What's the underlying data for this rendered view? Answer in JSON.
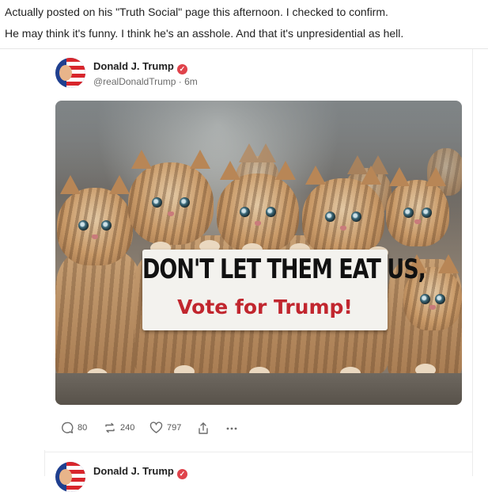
{
  "comment": {
    "line1": "Actually posted on his \"Truth Social\" page this afternoon. I checked to confirm.",
    "line2": "He may think it's funny.  I think he's an asshole.  And that it's unpresidential as hell."
  },
  "post": {
    "author_name": "Donald J. Trump",
    "handle": "@realDonaldTrump · 6m",
    "image": {
      "sign_line1": "DON'T LET THEM EAT US,",
      "sign_line2": "Vote for Trump!"
    },
    "actions": {
      "replies": "80",
      "reposts": "240",
      "likes": "797"
    }
  },
  "next_post": {
    "author_name": "Donald J. Trump"
  },
  "colors": {
    "verified_badge": "#e0434b",
    "sign_red_text": "#c1262e",
    "icon_gray": "#6b6b6b"
  },
  "icons": {
    "reply": "speech-bubble-icon",
    "repost": "repost-arrows-icon",
    "like": "heart-icon",
    "share": "share-upload-icon",
    "more": "more-dots-icon",
    "verified": "verified-check-icon"
  }
}
